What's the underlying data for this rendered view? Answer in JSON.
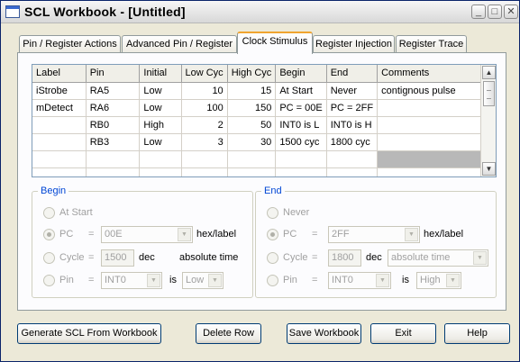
{
  "window": {
    "title": "SCL Workbook - [Untitled]",
    "controls": {
      "minimize": "_",
      "maximize": "□",
      "close": "✕"
    }
  },
  "tabs": [
    {
      "label": "Pin / Register Actions"
    },
    {
      "label": "Advanced Pin / Register"
    },
    {
      "label": "Clock Stimulus",
      "active": true
    },
    {
      "label": "Register Injection"
    },
    {
      "label": "Register Trace"
    }
  ],
  "grid": {
    "columns": [
      "Label",
      "Pin",
      "Initial",
      "Low Cyc",
      "High Cyc",
      "Begin",
      "End",
      "Comments"
    ],
    "rows": [
      [
        "iStrobe",
        "RA5",
        "Low",
        "10",
        "15",
        "At Start",
        "Never",
        "contignous pulse"
      ],
      [
        "mDetect",
        "RA6",
        "Low",
        "100",
        "150",
        "PC = 00E",
        "PC = 2FF",
        ""
      ],
      [
        "",
        "RB0",
        "High",
        "2",
        "50",
        "INT0 is L",
        "INT0 is H",
        ""
      ],
      [
        "",
        "RB3",
        "Low",
        "3",
        "30",
        "1500 cyc",
        "1800 cyc",
        ""
      ],
      [
        "",
        "",
        "",
        "",
        "",
        "",
        "",
        ""
      ],
      [
        "",
        "",
        "",
        "",
        "",
        "",
        "",
        ""
      ]
    ]
  },
  "begin": {
    "legend": "Begin",
    "at_start_label": "At Start",
    "pc_label": "PC",
    "pc_value": "00E",
    "pc_suffix": "hex/label",
    "cycle_label": "Cycle",
    "cycle_value": "1500",
    "cycle_unit": "dec",
    "cycle_mode": "absolute time",
    "pin_label": "Pin",
    "pin_value": "INT0",
    "is_label": "is",
    "pin_state": "Low",
    "equals": "="
  },
  "end": {
    "legend": "End",
    "never_label": "Never",
    "pc_label": "PC",
    "pc_value": "2FF",
    "pc_suffix": "hex/label",
    "cycle_label": "Cycle",
    "cycle_value": "1800",
    "cycle_unit": "dec",
    "cycle_mode": "absolute time",
    "pin_label": "Pin",
    "pin_value": "INT0",
    "is_label": "is",
    "pin_state": "High",
    "equals": "="
  },
  "buttons": {
    "generate": "Generate SCL From Workbook",
    "delete_row": "Delete Row",
    "save": "Save Workbook",
    "exit": "Exit",
    "help": "Help"
  },
  "icons": {
    "scroll_up": "▲",
    "scroll_down": "▼",
    "combo_arrow": "▼"
  }
}
